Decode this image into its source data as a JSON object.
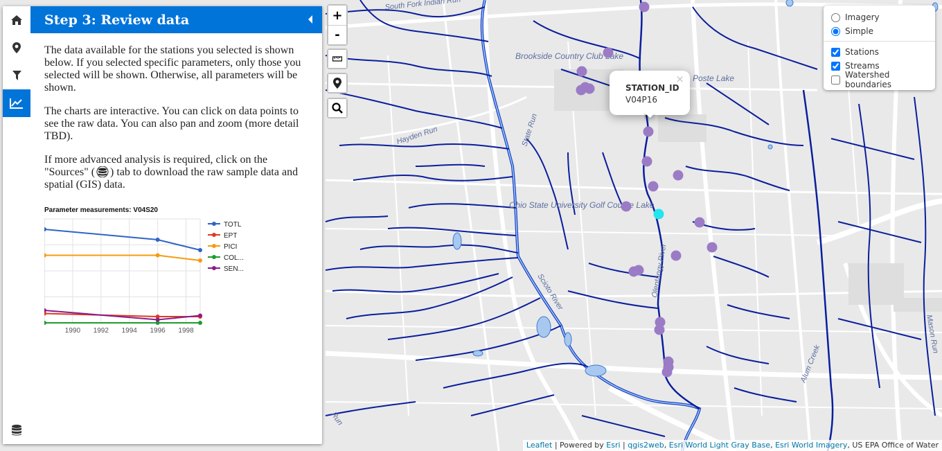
{
  "sidebar": {
    "tabs": [
      {
        "name": "home-icon",
        "active": false
      },
      {
        "name": "map-marker-icon",
        "active": false
      },
      {
        "name": "filter-icon",
        "active": false
      },
      {
        "name": "line-chart-icon",
        "active": true
      }
    ],
    "bottom_tab": "database-icon",
    "pane": {
      "title": "Step 3: Review data",
      "paragraph1": "The data available for the stations you selected is shown below. If you selected specific parameters, only those you selected will be shown. Otherwise, all parameters will be shown.",
      "paragraph2": "The charts are interactive. You can click on data points to see the raw data. You can also pan and zoom (more detail TBD).",
      "paragraph3_pre": "If more advanced analysis is required, click on the \"Sources\" (",
      "paragraph3_post": ") tab to download the raw sample data and spatial (GIS) data."
    }
  },
  "chart_data": {
    "type": "line",
    "title": "Parameter measurements: V04S20",
    "x": [
      1988,
      1996,
      1999
    ],
    "xlim": [
      1988,
      1999
    ],
    "x_ticks": [
      "1990",
      "1992",
      "1994",
      "1996",
      "1998"
    ],
    "ylim": [
      0,
      100
    ],
    "grid": true,
    "legend_position": "right",
    "series": [
      {
        "name": "TOTL",
        "color": "#2f64c6",
        "values": [
          90,
          80,
          70
        ]
      },
      {
        "name": "EPT",
        "color": "#dd3a23",
        "values": [
          9,
          6,
          6
        ]
      },
      {
        "name": "PICI",
        "color": "#f59b0f",
        "values": [
          65,
          65,
          60
        ]
      },
      {
        "name": "COL...",
        "color": "#1e9a30",
        "values": [
          0,
          0,
          0
        ]
      },
      {
        "name": "SEN...",
        "color": "#8b1c8b",
        "values": [
          12,
          3,
          7
        ]
      }
    ]
  },
  "map": {
    "zoom_in": "+",
    "zoom_out": "-",
    "popup": {
      "key": "STATION_ID",
      "value": "V04P16",
      "close": "×"
    },
    "layers": {
      "base": [
        {
          "label": "Imagery",
          "checked": false
        },
        {
          "label": "Simple",
          "checked": true
        }
      ],
      "overlays": [
        {
          "label": "Stations",
          "checked": true
        },
        {
          "label": "Streams",
          "checked": true
        },
        {
          "label": "Watershed boundaries",
          "checked": false
        }
      ]
    },
    "labels": [
      {
        "text": "South Fork Indian Run"
      },
      {
        "text": "Brookside Country Club Lake"
      },
      {
        "text": "Poste Lake"
      },
      {
        "text": "Hayden Run"
      },
      {
        "text": "State Run"
      },
      {
        "text": "Ohio State University Golf Course Lake"
      },
      {
        "text": "Scioto River"
      },
      {
        "text": "Olentangy River"
      },
      {
        "text": "Alum Creek"
      },
      {
        "text": "Mason Run"
      },
      {
        "text": "Run"
      }
    ],
    "stations_color": "#9b7bc5",
    "selected_station_color": "#22e5ee",
    "stream_color": "#0a1e9c",
    "attribution": {
      "leaflet": "Leaflet",
      "sep1": " | Powered by ",
      "esri": "Esri",
      "sep2": " | ",
      "qgis": "qgis2web",
      "sep3": ", ",
      "light_gray": "Esri World Light Gray Base",
      "sep4": ", ",
      "imagery": "Esri World Imagery",
      "rest": ", US EPA Office of Water"
    }
  }
}
